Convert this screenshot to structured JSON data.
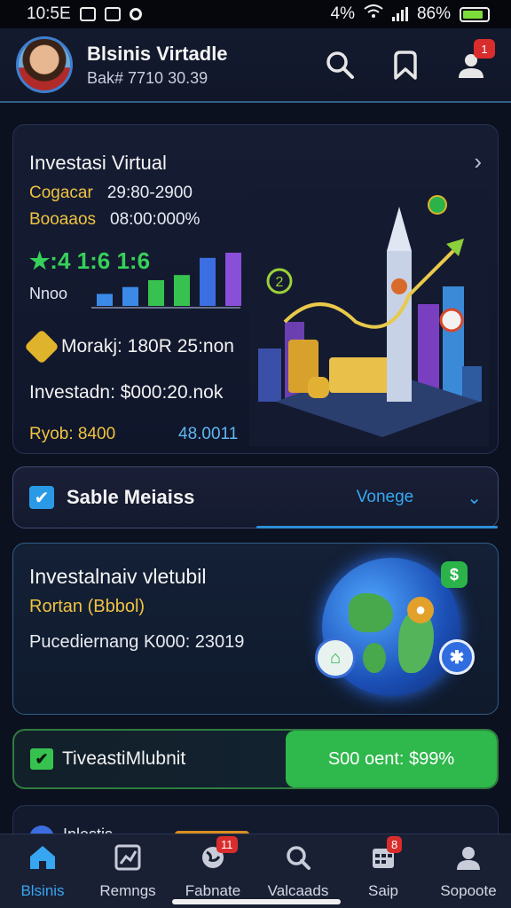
{
  "status_bar": {
    "time": "10:5E",
    "right_text": "4% ",
    "battery_text": "86%"
  },
  "header": {
    "title": "Blsinis Virtadle",
    "subtitle": "Bak# 7710 30.39",
    "notif_badge": "1"
  },
  "card_virtual": {
    "title": "Investasi Virtual",
    "row1_label": "Cogacar",
    "row1_value": "29:80-2900",
    "row2_label": "Booaaos",
    "row2_value": "08:00:000%",
    "bars_label": "★:4  1:6  1:6",
    "small_label": "Nnoo",
    "money_line": "Morakj: 180R 25:non",
    "invest_line": "Investadn: $000:20.nok",
    "profit_label": "Ryob: 8400",
    "profit_value": "48.0011",
    "art_badge": "2",
    "chart_values": [
      14,
      22,
      30,
      36,
      56,
      62
    ]
  },
  "card_select": {
    "label": "Sable Meiaiss",
    "selected": "Vonege"
  },
  "card_global": {
    "title": "Investalnaiv vletubil",
    "subtitle": "Rortan (Bbbol)",
    "line": "Pucediernang K000: 23019",
    "badge_dollar": "$"
  },
  "card_green": {
    "label": "TiveastiMlubnit",
    "button": "S00 oent: $99%"
  },
  "card_partial": {
    "label": "Inlestis"
  },
  "bottom_nav": [
    {
      "label": "Blsinis",
      "icon": "home-icon",
      "badge": ""
    },
    {
      "label": "Remngs",
      "icon": "chart-icon",
      "badge": ""
    },
    {
      "label": "Fabnate",
      "icon": "globe-icon",
      "badge": "11"
    },
    {
      "label": "Valcaads",
      "icon": "search-icon",
      "badge": ""
    },
    {
      "label": "Saip",
      "icon": "calendar-icon",
      "badge": "8"
    },
    {
      "label": "Sopoote",
      "icon": "user-icon",
      "badge": ""
    }
  ],
  "colors": {
    "accent_blue": "#37a6f0",
    "gold": "#f0c341",
    "green": "#2fb84c",
    "badge_red": "#d92d2d"
  }
}
